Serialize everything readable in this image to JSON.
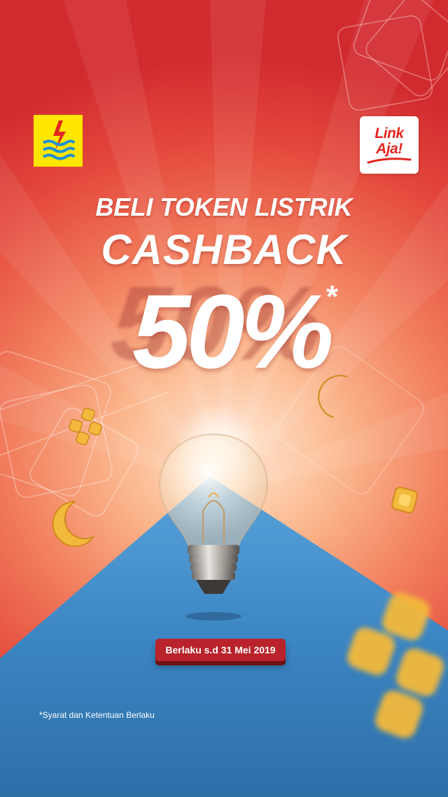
{
  "brand": {
    "pln_logo": "pln-lightning-logo",
    "linkaja_line1": "Link",
    "linkaja_line2": "Aja!"
  },
  "headline": {
    "line1": "BELI TOKEN LISTRIK",
    "line2": "CASHBACK",
    "percent": "50%",
    "asterisk": "*"
  },
  "promo": {
    "validity": "Berlaku s.d 31 Mei 2019"
  },
  "footnote": "*Syarat dan Ketentuan Berlaku",
  "colors": {
    "background_red": "#d22b2f",
    "pln_yellow": "#ffe600",
    "linkaja_red": "#e2261f",
    "mountain_blue": "#3d8cc9",
    "badge_red": "#b9232b"
  }
}
